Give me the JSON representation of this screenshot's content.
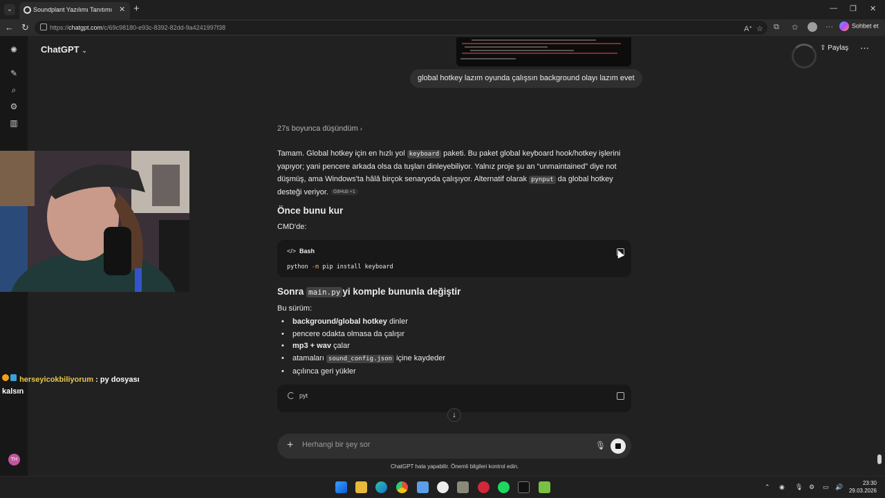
{
  "browser": {
    "tab_title": "Soundplant Yazılımı Tanıtımı",
    "url_prefix": "https://",
    "url_host": "chatgpt.com",
    "url_path": "/c/69c98180-e93c-8392-82dd-9a4241997f38",
    "copilot_label": "Sohbet et"
  },
  "header": {
    "model": "ChatGPT",
    "share_label": "Paylaş"
  },
  "conversation": {
    "user_message": "global hotkey lazım oyunda çalışsın background olayı lazım evet",
    "thought_label": "27s boyunca düşündüm",
    "para_1": "Tamam. Global hotkey için en hızlı yol",
    "code_keyboard": "keyboard",
    "para_2": "paketi. Bu paket global keyboard hook/hotkey işlerini yapıyor; yani pencere arkada olsa da tuşları dinleyebiliyor. Yalnız proje şu an “unmaintained” diye not düşmüş, ama Windows'ta hâlâ birçok senaryoda çalışıyor. Alternatif olarak",
    "code_pynput": "pynput",
    "para_3": "da global hotkey desteği veriyor.",
    "source_badge": "GitHub +1",
    "heading_install": "Önce bunu kur",
    "cmd_label": "CMD'de:",
    "code_lang": "Bash",
    "code_cmd_1": "python",
    "code_cmd_flag": "-m",
    "code_cmd_2": "pip install keyboard",
    "heading_replace_prefix": "Sonra",
    "heading_replace_code": "main.py",
    "heading_replace_suffix": "yi komple bununla değiştir",
    "version_label": "Bu sürüm:",
    "bullet_1_bold": "background/global hotkey",
    "bullet_1_rest": "dinler",
    "bullet_2": "pencere odakta olmasa da çalışır",
    "bullet_3_bold": "mp3 + wav",
    "bullet_3_rest": "çalar",
    "bullet_4_pre": "atamaları",
    "bullet_4_code": "sound_config.json",
    "bullet_4_post": "içine kaydeder",
    "bullet_5": "açılınca geri yükler",
    "loading_code_label": "pyt"
  },
  "composer": {
    "placeholder": "Herhangi bir şey sor",
    "disclaimer": "ChatGPT hata yapabilir. Önemli bilgileri kontrol edin."
  },
  "stream_chat": {
    "username": "herseyicokbiliyorum",
    "message": ": py dosyası kalsın"
  },
  "sidebar": {
    "avatar_initials": "TH"
  },
  "taskbar": {
    "time": "23:30",
    "date": "29.03.2026"
  }
}
